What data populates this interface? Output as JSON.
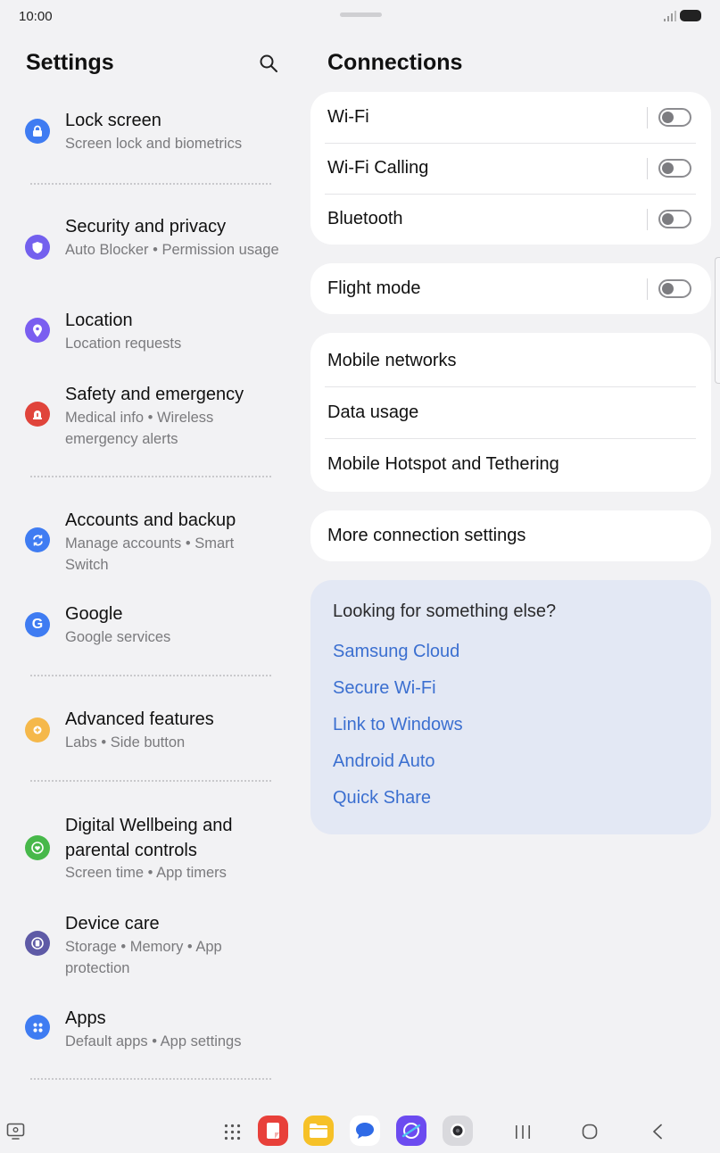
{
  "status_bar": {
    "time": "10:00"
  },
  "left_pane": {
    "title": "Settings",
    "items": [
      {
        "title": "Lock screen",
        "subtitle": "Screen lock and biometrics",
        "icon": "lock-icon",
        "color": "#3f7cf2"
      },
      {
        "title": "Security and privacy",
        "subtitle": "Auto Blocker  •  Permission usage",
        "icon": "shield-icon",
        "color": "#7360ee"
      },
      {
        "title": "Location",
        "subtitle": "Location requests",
        "icon": "location-pin-icon",
        "color": "#7a5ef0"
      },
      {
        "title": "Safety and emergency",
        "subtitle": "Medical info  •  Wireless emergency alerts",
        "icon": "siren-icon",
        "color": "#e0443b"
      },
      {
        "title": "Accounts and backup",
        "subtitle": "Manage accounts  •  Smart Switch",
        "icon": "sync-icon",
        "color": "#3f7cf2"
      },
      {
        "title": "Google",
        "subtitle": "Google services",
        "icon": "google-g-icon",
        "color": "#3f7cf2"
      },
      {
        "title": "Advanced features",
        "subtitle": "Labs  •  Side button",
        "icon": "gear-plus-icon",
        "color": "#f5b84a"
      },
      {
        "title": "Digital Wellbeing and parental controls",
        "subtitle": "Screen time  •  App timers",
        "icon": "wellbeing-heart-icon",
        "color": "#47b84a"
      },
      {
        "title": "Device care",
        "subtitle": "Storage  •  Memory  •  App protection",
        "icon": "device-care-icon",
        "color": "#5e5aa6"
      },
      {
        "title": "Apps",
        "subtitle": "Default apps  •  App settings",
        "icon": "apps-grid-icon",
        "color": "#3f7cf2"
      }
    ]
  },
  "right_pane": {
    "title": "Connections",
    "card1": [
      {
        "label": "Wi-Fi",
        "toggle": false
      },
      {
        "label": "Wi-Fi Calling",
        "toggle": false
      },
      {
        "label": "Bluetooth",
        "toggle": false
      }
    ],
    "card2": [
      {
        "label": "Flight mode",
        "toggle": false
      }
    ],
    "card3": [
      {
        "label": "Mobile networks"
      },
      {
        "label": "Data usage"
      },
      {
        "label": "Mobile Hotspot and Tethering"
      }
    ],
    "card4": [
      {
        "label": "More connection settings"
      }
    ],
    "suggestions": {
      "title": "Looking for something else?",
      "links": [
        "Samsung Cloud",
        "Secure Wi-Fi",
        "Link to Windows",
        "Android Auto",
        "Quick Share"
      ]
    }
  },
  "nav_bar": {
    "dock_apps": [
      "notes-app-icon",
      "my-files-app-icon",
      "messages-app-icon",
      "internet-app-icon",
      "camera-app-icon"
    ]
  }
}
